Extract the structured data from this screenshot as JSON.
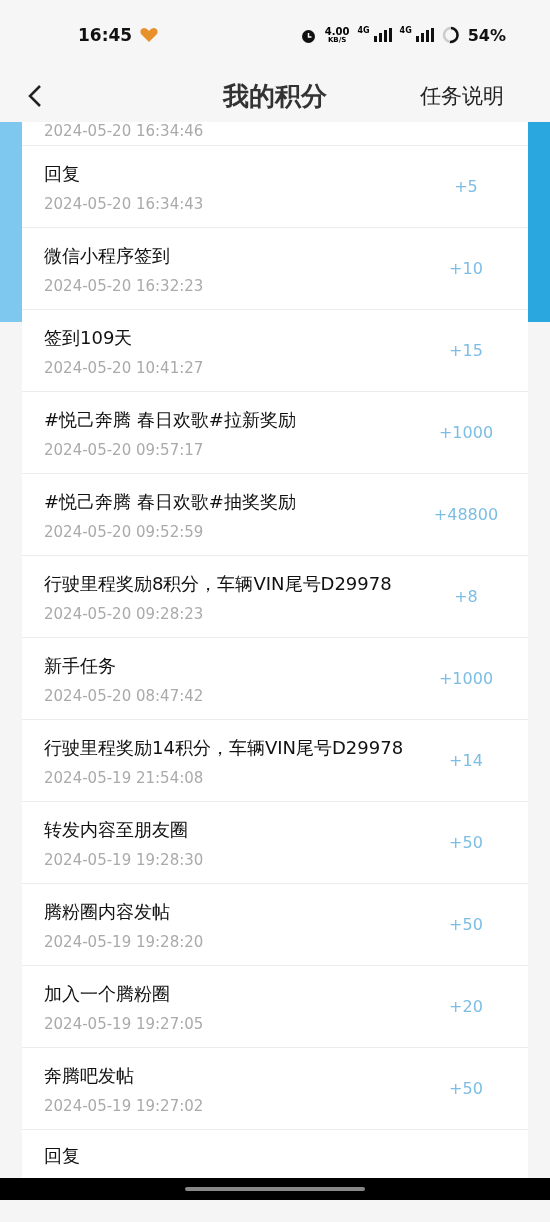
{
  "status_bar": {
    "time": "16:45",
    "speed": "4.00",
    "speed_unit": "KB/S",
    "network_1": "4G",
    "network_2": "4G",
    "battery": "54%"
  },
  "header": {
    "title": "我的积分",
    "action": "任务说明"
  },
  "records": [
    {
      "date": "2024-05-20 16:34:46"
    },
    {
      "title": "回复",
      "date": "2024-05-20 16:34:43",
      "points": "+5"
    },
    {
      "title": "微信小程序签到",
      "date": "2024-05-20 16:32:23",
      "points": "+10"
    },
    {
      "title": "签到109天",
      "date": "2024-05-20 10:41:27",
      "points": "+15"
    },
    {
      "title": "#悦己奔腾 春日欢歌#拉新奖励",
      "date": "2024-05-20 09:57:17",
      "points": "+1000"
    },
    {
      "title": "#悦己奔腾 春日欢歌#抽奖奖励",
      "date": "2024-05-20 09:52:59",
      "points": "+48800"
    },
    {
      "title": "行驶里程奖励8积分，车辆VIN尾号D29978",
      "date": "2024-05-20 09:28:23",
      "points": "+8"
    },
    {
      "title": "新手任务",
      "date": "2024-05-20 08:47:42",
      "points": "+1000"
    },
    {
      "title": "行驶里程奖励14积分，车辆VIN尾号D29978",
      "date": "2024-05-19 21:54:08",
      "points": "+14"
    },
    {
      "title": "转发内容至朋友圈",
      "date": "2024-05-19 19:28:30",
      "points": "+50"
    },
    {
      "title": "腾粉圈内容发帖",
      "date": "2024-05-19 19:28:20",
      "points": "+50"
    },
    {
      "title": "加入一个腾粉圈",
      "date": "2024-05-19 19:27:05",
      "points": "+20"
    },
    {
      "title": "奔腾吧发帖",
      "date": "2024-05-19 19:27:02",
      "points": "+50"
    },
    {
      "title": "回复"
    }
  ]
}
